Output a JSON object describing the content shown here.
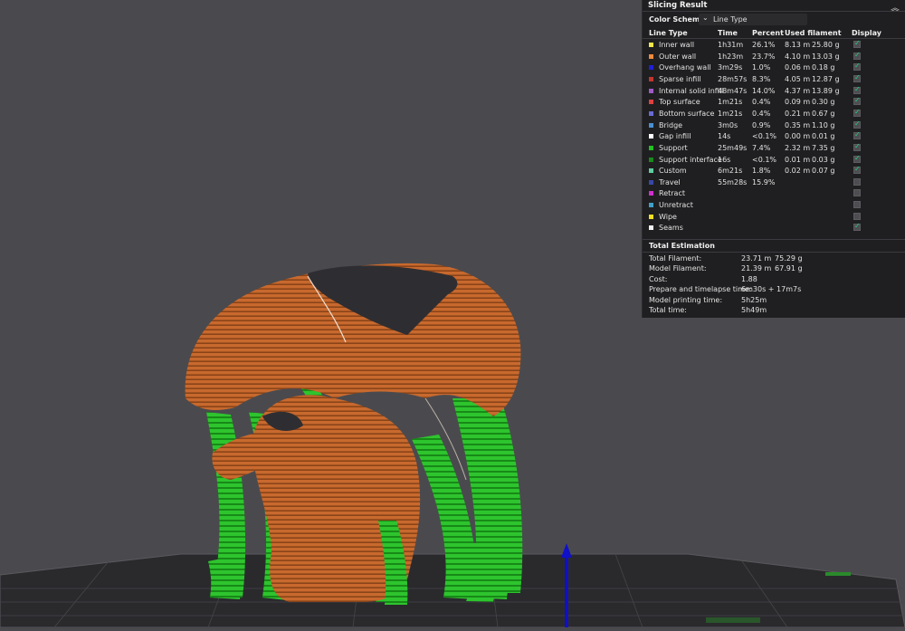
{
  "panel": {
    "title": "Slicing Result",
    "color_scheme_label": "Color Scheme",
    "color_scheme_value": "Line Type",
    "headers": {
      "line_type": "Line Type",
      "time": "Time",
      "percent": "Percent",
      "used_filament": "Used filament",
      "display": "Display"
    },
    "rows": [
      {
        "name": "Inner wall",
        "time": "1h31m",
        "percent": "26.1%",
        "length": "8.13 m",
        "weight": "25.80 g",
        "color": "#f5e74a",
        "display": true
      },
      {
        "name": "Outer wall",
        "time": "1h23m",
        "percent": "23.7%",
        "length": "4.10 m",
        "weight": "13.03 g",
        "color": "#f08a3c",
        "display": true
      },
      {
        "name": "Overhang wall",
        "time": "3m29s",
        "percent": "1.0%",
        "length": "0.06 m",
        "weight": "0.18 g",
        "color": "#2020d8",
        "display": true
      },
      {
        "name": "Sparse infill",
        "time": "28m57s",
        "percent": "8.3%",
        "length": "4.05 m",
        "weight": "12.87 g",
        "color": "#c4362e",
        "display": true
      },
      {
        "name": "Internal solid infill",
        "time": "48m47s",
        "percent": "14.0%",
        "length": "4.37 m",
        "weight": "13.89 g",
        "color": "#a05ac8",
        "display": true
      },
      {
        "name": "Top surface",
        "time": "1m21s",
        "percent": "0.4%",
        "length": "0.09 m",
        "weight": "0.30 g",
        "color": "#e04040",
        "display": true
      },
      {
        "name": "Bottom surface",
        "time": "1m21s",
        "percent": "0.4%",
        "length": "0.21 m",
        "weight": "0.67 g",
        "color": "#6a6ad8",
        "display": true
      },
      {
        "name": "Bridge",
        "time": "3m0s",
        "percent": "0.9%",
        "length": "0.35 m",
        "weight": "1.10 g",
        "color": "#4a90d0",
        "display": true
      },
      {
        "name": "Gap infill",
        "time": "14s",
        "percent": "<0.1%",
        "length": "0.00 m",
        "weight": "0.01 g",
        "color": "#ffffff",
        "display": true
      },
      {
        "name": "Support",
        "time": "25m49s",
        "percent": "7.4%",
        "length": "2.32 m",
        "weight": "7.35 g",
        "color": "#22c222",
        "display": true
      },
      {
        "name": "Support interface",
        "time": "16s",
        "percent": "<0.1%",
        "length": "0.01 m",
        "weight": "0.03 g",
        "color": "#1a8a1a",
        "display": true
      },
      {
        "name": "Custom",
        "time": "6m21s",
        "percent": "1.8%",
        "length": "0.02 m",
        "weight": "0.07 g",
        "color": "#5ecfa0",
        "display": true
      },
      {
        "name": "Travel",
        "time": "55m28s",
        "percent": "15.9%",
        "length": "",
        "weight": "",
        "color": "#3848a8",
        "display": false
      },
      {
        "name": "Retract",
        "time": "",
        "percent": "",
        "length": "",
        "weight": "",
        "color": "#d030d0",
        "display": false
      },
      {
        "name": "Unretract",
        "time": "",
        "percent": "",
        "length": "",
        "weight": "",
        "color": "#40a0c8",
        "display": false
      },
      {
        "name": "Wipe",
        "time": "",
        "percent": "",
        "length": "",
        "weight": "",
        "color": "#f5e020",
        "display": false
      },
      {
        "name": "Seams",
        "time": "",
        "percent": "",
        "length": "",
        "weight": "",
        "color": "#f0f0f0",
        "display": true
      }
    ],
    "total_title": "Total Estimation",
    "summary": [
      {
        "label": "Total Filament:",
        "v1": "23.71 m",
        "v2": "75.29 g"
      },
      {
        "label": "Model Filament:",
        "v1": "21.39 m",
        "v2": "67.91 g"
      },
      {
        "label": "Cost:",
        "v1": "1.88",
        "v2": ""
      },
      {
        "label": "Prepare and timelapse time:",
        "v1": "6m30s + 17m7s",
        "v2": ""
      },
      {
        "label": "Model printing time:",
        "v1": "5h25m",
        "v2": ""
      },
      {
        "label": "Total time:",
        "v1": "5h49m",
        "v2": ""
      }
    ]
  },
  "colors": {
    "background": "#4a4a4e",
    "outer_wall": "#c8692e",
    "support": "#2ec42e",
    "top_cap": "#2e2e32",
    "z_axis": "#1010c8"
  }
}
